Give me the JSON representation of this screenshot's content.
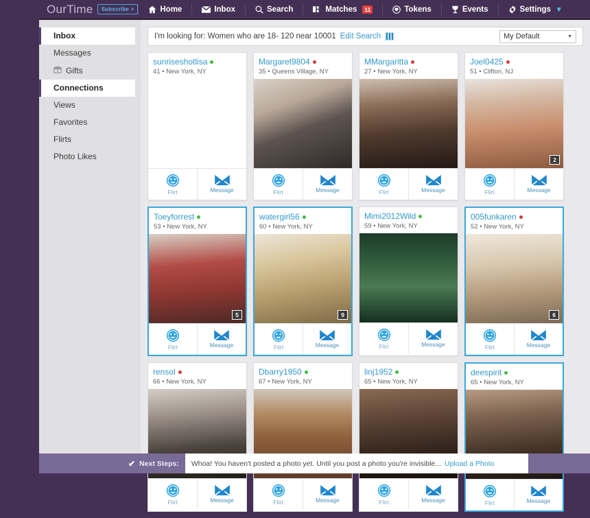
{
  "brand": {
    "logo": "OurTime",
    "subscribe_label": "Subscribe >"
  },
  "topnav": {
    "items": [
      {
        "label": "Home",
        "icon": "home-icon",
        "badge": null
      },
      {
        "label": "Inbox",
        "icon": "envelope-icon",
        "badge": null
      },
      {
        "label": "Search",
        "icon": "magnifier-icon",
        "badge": null
      },
      {
        "label": "Matches",
        "icon": "cards-icon",
        "badge": "11"
      },
      {
        "label": "Tokens",
        "icon": "token-icon",
        "badge": null
      },
      {
        "label": "Events",
        "icon": "trophy-icon",
        "badge": null
      },
      {
        "label": "Settings",
        "icon": "gear-icon",
        "badge": null
      }
    ],
    "caret": "▾"
  },
  "sidebar": {
    "items": [
      {
        "label": "Inbox",
        "active": true,
        "icon": null
      },
      {
        "label": "Messages",
        "active": false,
        "icon": null
      },
      {
        "label": "Gifts",
        "active": false,
        "icon": "gift-icon"
      },
      {
        "label": "Connections",
        "active": true,
        "icon": null
      },
      {
        "label": "Views",
        "active": false,
        "icon": null
      },
      {
        "label": "Favorites",
        "active": false,
        "icon": null
      },
      {
        "label": "Flirts",
        "active": false,
        "icon": null
      },
      {
        "label": "Photo Likes",
        "active": false,
        "icon": null
      }
    ]
  },
  "search": {
    "criteria_text": "I'm looking for: Women who are 18- 120 near 10001",
    "edit_label": "Edit Search",
    "filter_icon": "sliders-icon",
    "preset_value": "My Default",
    "preset_caret": "▾"
  },
  "actions": {
    "flirt_label": "Flirt",
    "message_label": "Message",
    "flirt_icon": "smiley-icon",
    "message_icon": "envelope-icon"
  },
  "profiles": [
    {
      "username": "sunriseshotlisa",
      "age": "41",
      "location": "New York, NY",
      "status": "online",
      "photo_count": null,
      "selected": false,
      "has_photo": false,
      "art": ""
    },
    {
      "username": "Margaret9804",
      "age": "35",
      "location": "Queens Village, NY",
      "status": "offline",
      "photo_count": null,
      "selected": false,
      "has_photo": true,
      "art": "ph2"
    },
    {
      "username": "MMargaritta",
      "age": "27",
      "location": "New York, NY",
      "status": "offline",
      "photo_count": null,
      "selected": false,
      "has_photo": true,
      "art": "ph9"
    },
    {
      "username": "Joel0425",
      "age": "51",
      "location": "Clifton, NJ",
      "status": "offline",
      "photo_count": "2",
      "selected": false,
      "has_photo": true,
      "art": "ph3"
    },
    {
      "username": "Toeyforrest",
      "age": "53",
      "location": "New York, NY",
      "status": "online",
      "photo_count": "5",
      "selected": true,
      "has_photo": true,
      "art": "ph5"
    },
    {
      "username": "watergirl56",
      "age": "60",
      "location": "New York, NY",
      "status": "online",
      "photo_count": "9",
      "selected": true,
      "has_photo": true,
      "art": "ph6"
    },
    {
      "username": "Mimi2012Wild",
      "age": "59",
      "location": "New York, NY",
      "status": "online",
      "photo_count": null,
      "selected": false,
      "has_photo": true,
      "art": "ph7"
    },
    {
      "username": "005funkaren",
      "age": "52",
      "location": "New York, NY",
      "status": "offline",
      "photo_count": "6",
      "selected": true,
      "has_photo": true,
      "art": "ph8"
    },
    {
      "username": "rensol",
      "age": "66",
      "location": "New York, NY",
      "status": "offline",
      "photo_count": null,
      "selected": false,
      "has_photo": true,
      "art": "ph10"
    },
    {
      "username": "Dbarry1950",
      "age": "67",
      "location": "New York, NY",
      "status": "online",
      "photo_count": null,
      "selected": false,
      "has_photo": true,
      "art": "ph4"
    },
    {
      "username": "linj1952",
      "age": "65",
      "location": "New York, NY",
      "status": "online",
      "photo_count": null,
      "selected": false,
      "has_photo": true,
      "art": "ph11"
    },
    {
      "username": "deespirit",
      "age": "65",
      "location": "New York, NY",
      "status": "online",
      "photo_count": null,
      "selected": true,
      "has_photo": true,
      "art": "ph12"
    }
  ],
  "bottombar": {
    "next_steps_label": "Next Steps:",
    "notice_text": "Whoa! You haven't posted a photo yet. Until you post a photo you're invisible...",
    "upload_label": "Upload a Photo",
    "check_icon": "check-icon"
  },
  "colors": {
    "page_bg": "#453055",
    "nav_bg": "#453055",
    "accent_blue": "#3399cc",
    "selected_border": "#3aa7dd",
    "online": "#3cbf3c",
    "offline": "#cf3b3b",
    "badge_red": "#e0413c",
    "bottombar_bg": "#7a6a96"
  }
}
